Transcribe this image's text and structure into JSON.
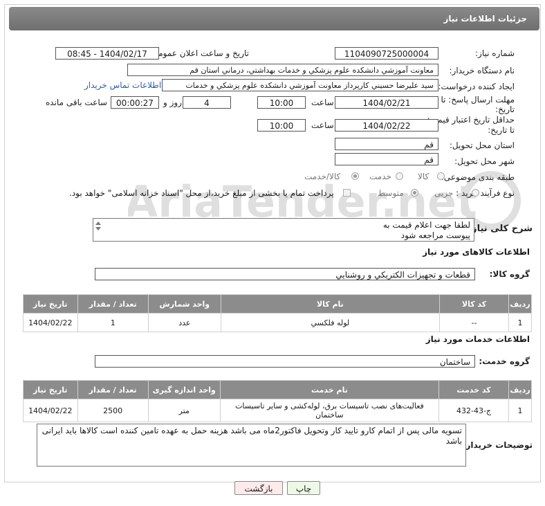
{
  "page_title": "جزئیات اطلاعات نیاز",
  "fields": {
    "need_number_label": "شماره نیاز:",
    "need_number": "1104090725000004",
    "announce_label": "تاریخ و ساعت اعلان عمومی:",
    "announce_value": "1404/02/17 - 08:45",
    "buyer_org_label": "نام دستگاه خریدار:",
    "buyer_org": "معاونت آموزشي دانشكده علوم پزشكي و خدمات بهداشتي، درماني استان قم",
    "creator_label": "ایجاد کننده درخواست:",
    "creator": "سيد عليرضا حسيني كارپرداز معاونت آموزشي دانشكده علوم پزشكي و خدمات",
    "contact_link": "اطلاعات تماس خریدار",
    "deadline_label_1": "مهلت ارسال پاسخ: تا",
    "deadline_label_2": "تاریخ:",
    "deadline_date": "1404/02/21",
    "time_label": "ساعت",
    "deadline_time": "10:00",
    "days_value": "4",
    "days_label": "روز و",
    "remaining_value": "00:00:27",
    "remaining_label": "ساعت باقی مانده",
    "validity_label_1": "حداقل تاریخ اعتبار قیمت:",
    "validity_label_2": "تا تاریخ:",
    "validity_date": "1404/02/22",
    "validity_time": "10:00",
    "province_label": "استان محل تحویل:",
    "province": "قم",
    "city_label": "شهر محل تحویل:",
    "city": "قم",
    "category_label": "طبقه بندی موضوعی:",
    "category_options": [
      "کالا",
      "خدمت",
      "کالا/خدمت"
    ],
    "process_label": "نوع فرآیند خرید :",
    "process_options": [
      "جزیی",
      "متوسط"
    ],
    "payment_note": "پرداخت تمام یا بخشی از مبلغ خرید،از محل \"اسناد خزانه اسلامی\" خواهد بود."
  },
  "description": {
    "label": "شرح کلی نیاز:",
    "line1": "لطفا جهت اعلام قیمت به",
    "line2": "پیوست مراجعه شود"
  },
  "goods": {
    "section_title": "اطلاعات کالاهای مورد نیاز",
    "group_label": "گروه کالا:",
    "group_value": "قطعات و تجهيزات الكتريكي و روشنايي",
    "headers": [
      "ردیف",
      "کد کالا",
      "نام کالا",
      "واحد شمارش",
      "تعداد / مقدار",
      "تاریخ نیاز"
    ],
    "rows": [
      [
        "1",
        "--",
        "لوله فلكسي",
        "عدد",
        "1",
        "1404/02/22"
      ]
    ]
  },
  "services": {
    "section_title": "اطلاعات خدمات مورد نیاز",
    "group_label": "گروه خدمت:",
    "group_value": "ساختمان",
    "headers": [
      "ردیف",
      "کد خدمت",
      "نام خدمت",
      "واحد اندازه گیری",
      "تعداد / مقدار",
      "تاریخ نیاز"
    ],
    "rows": [
      [
        "1",
        "ج-43-432",
        "فعالیت‌های نصب تاسیسات برق، لوله‌کشی و سایر تاسیسات ساختمان",
        "متر",
        "2500",
        "1404/02/22"
      ]
    ]
  },
  "buyer_notes": {
    "label": "توضیحات خریدار:",
    "text": "تسویه مالی پس از اتمام کارو تایید کار وتحویل فاکتور2ماه می باشد هزینه حمل به عهده تامین کننده است کالاها باید ایرانی باشد"
  },
  "buttons": {
    "print": "چاپ",
    "back": "بازگشت"
  },
  "watermark_text": "AriaTender.net"
}
